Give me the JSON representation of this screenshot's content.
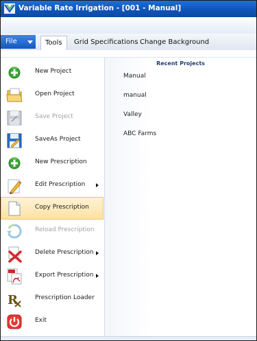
{
  "window": {
    "title": "Variable Rate Irrigation - [001 - Manual]",
    "titlebar_color": "#0f56b9"
  },
  "ribbon": {
    "file_label": "File",
    "tabs": [
      "Tools",
      "Grid Specifications",
      "Change Background"
    ],
    "active_tab": "Tools"
  },
  "menu": {
    "items": [
      {
        "label": "New Project",
        "icon": "new-project-icon",
        "enabled": true,
        "submenu": false
      },
      {
        "label": "Open Project",
        "icon": "open-folder-icon",
        "enabled": true,
        "submenu": false
      },
      {
        "label": "Save Project",
        "icon": "save-icon",
        "enabled": false,
        "submenu": false
      },
      {
        "label": "SaveAs Project",
        "icon": "saveas-icon",
        "enabled": true,
        "submenu": false
      },
      {
        "label": "New Prescription",
        "icon": "new-prescription-icon",
        "enabled": true,
        "submenu": false
      },
      {
        "label": "Edit Prescription",
        "icon": "edit-pencil-icon",
        "enabled": true,
        "submenu": true
      },
      {
        "label": "Copy Prescription",
        "icon": "copy-document-icon",
        "enabled": true,
        "submenu": false,
        "highlighted": true
      },
      {
        "label": "Reload Prescription",
        "icon": "reload-icon",
        "enabled": false,
        "submenu": false
      },
      {
        "label": "Delete Prescription",
        "icon": "delete-icon",
        "enabled": true,
        "submenu": true
      },
      {
        "label": "Export Prescription",
        "icon": "export-pdf-icon",
        "enabled": true,
        "submenu": true
      },
      {
        "label": "Prescription Loader",
        "icon": "rx-icon",
        "enabled": true,
        "submenu": false
      },
      {
        "label": "Exit",
        "icon": "power-icon",
        "enabled": true,
        "submenu": false
      }
    ],
    "highlight_color": "#fde1a4"
  },
  "recent": {
    "header": "Recent Projects",
    "items": [
      "Manual",
      "manual",
      "Valley",
      "ABC Farms"
    ]
  }
}
